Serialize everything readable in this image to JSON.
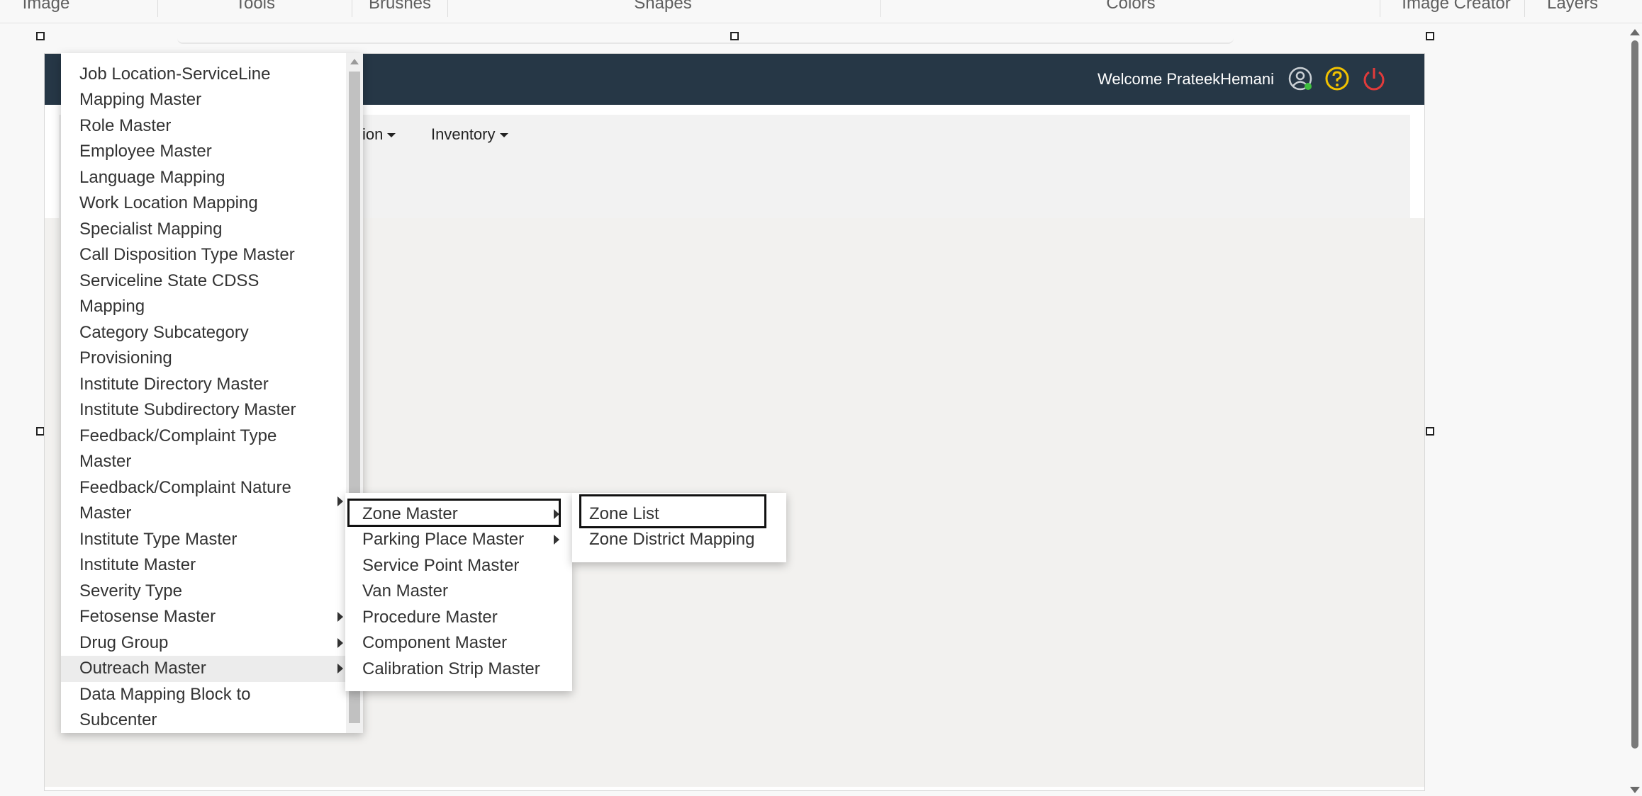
{
  "ribbon": {
    "sections": [
      "Image",
      "Tools",
      "Brushes",
      "Shapes",
      "Colors",
      "Image Creator",
      "Layers"
    ]
  },
  "header": {
    "welcome": "Welcome PrateekHemani",
    "colors": {
      "bg": "#263746",
      "help": "#f2c200",
      "power": "#e23b3b"
    }
  },
  "nav": {
    "partial_item": "ion",
    "inventory": "Inventory"
  },
  "menu_level1": {
    "items": [
      "Job Location-ServiceLine",
      "Mapping Master",
      "Role Master",
      "Employee Master",
      "Language Mapping",
      "Work Location Mapping",
      "Specialist Mapping",
      "Call Disposition Type Master",
      "Serviceline State CDSS",
      "Mapping",
      "Category Subcategory",
      "Provisioning",
      "Institute Directory Master",
      "Institute Subdirectory Master",
      "Feedback/Complaint Type",
      "Master",
      "Feedback/Complaint Nature",
      "Master",
      "Institute Type Master",
      "Institute Master",
      "Severity Type",
      "Fetosense Master",
      "Drug Group",
      "Outreach Master",
      "Data Mapping Block to",
      "Subcenter"
    ]
  },
  "menu_level2": {
    "items": [
      "Zone Master",
      "Parking Place Master",
      "Service Point Master",
      "Van Master",
      "Procedure Master",
      "Component Master",
      "Calibration Strip Master"
    ]
  },
  "menu_level3": {
    "items": [
      "Zone List",
      "Zone District Mapping"
    ]
  }
}
